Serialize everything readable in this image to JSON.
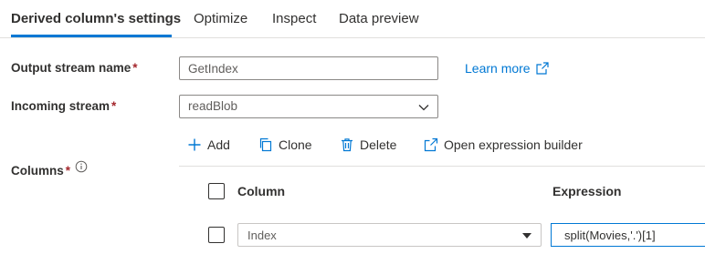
{
  "tabs": [
    {
      "label": "Derived column's settings"
    },
    {
      "label": "Optimize"
    },
    {
      "label": "Inspect"
    },
    {
      "label": "Data preview"
    }
  ],
  "form": {
    "output_stream_label": "Output stream name",
    "output_stream_value": "GetIndex",
    "incoming_stream_label": "Incoming stream",
    "incoming_stream_value": "readBlob",
    "columns_label": "Columns",
    "required_marker": "*",
    "learn_more": "Learn more"
  },
  "toolbar": {
    "add": "Add",
    "clone": "Clone",
    "delete": "Delete",
    "open_builder": "Open expression builder"
  },
  "grid": {
    "headers": {
      "column": "Column",
      "expression": "Expression"
    },
    "rows": [
      {
        "column": "Index",
        "expression": "split(Movies,'.')[1]"
      }
    ]
  },
  "colors": {
    "accent": "#0078d4",
    "required": "#a4262c",
    "text": "#323130"
  }
}
